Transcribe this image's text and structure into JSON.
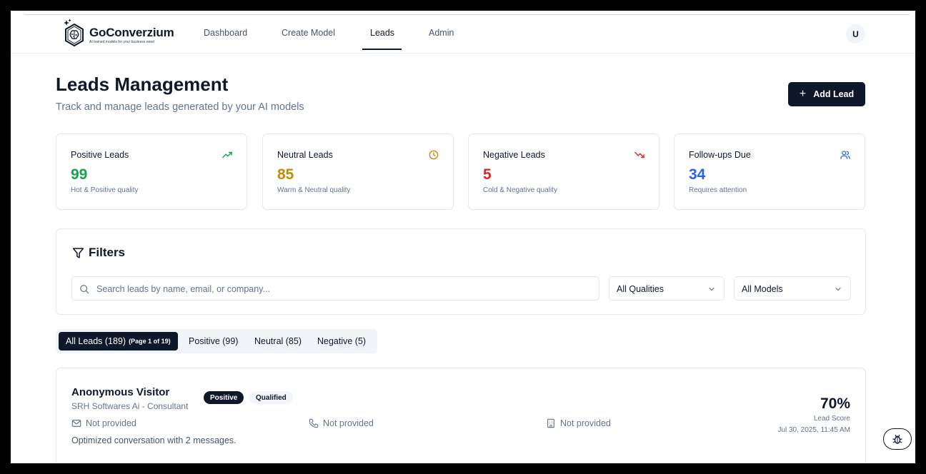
{
  "brand": {
    "name": "GoConverzium",
    "tagline": "AI trained models for your business need"
  },
  "nav": {
    "links": [
      "Dashboard",
      "Create Model",
      "Leads",
      "Admin"
    ],
    "active": "Leads",
    "user_initial": "U"
  },
  "header": {
    "title": "Leads Management",
    "subtitle": "Track and manage leads generated by your AI models",
    "add_button": "Add Lead"
  },
  "stats": [
    {
      "label": "Positive Leads",
      "value": "99",
      "desc": "Hot & Positive quality",
      "color": "#16a34a",
      "icon": "trending-up-icon"
    },
    {
      "label": "Neutral Leads",
      "value": "85",
      "desc": "Warm & Neutral quality",
      "color": "#ca8a04",
      "icon": "clock-icon"
    },
    {
      "label": "Negative Leads",
      "value": "5",
      "desc": "Cold & Negative quality",
      "color": "#dc2626",
      "icon": "trending-down-icon"
    },
    {
      "label": "Follow-ups Due",
      "value": "34",
      "desc": "Requires attention",
      "color": "#2563eb",
      "icon": "users-icon"
    }
  ],
  "filters": {
    "title": "Filters",
    "search_placeholder": "Search leads by name, email, or company...",
    "quality_select": "All Qualities",
    "model_select": "All Models"
  },
  "tabs": {
    "all": "All Leads (189)",
    "page_info": "(Page 1 of 19)",
    "positive": "Positive (99)",
    "neutral": "Neutral (85)",
    "negative": "Negative (5)"
  },
  "lead": {
    "name": "Anonymous Visitor",
    "badge_quality": "Positive",
    "badge_status": "Qualified",
    "company": "SRH Softwares Ai - Consultant",
    "email": "Not provided",
    "phone": "Not provided",
    "org": "Not provided",
    "summary": "Optimized conversation with 2 messages.",
    "score": "70%",
    "score_label": "Lead Score",
    "date": "Jul 30, 2025, 11:45 AM"
  }
}
